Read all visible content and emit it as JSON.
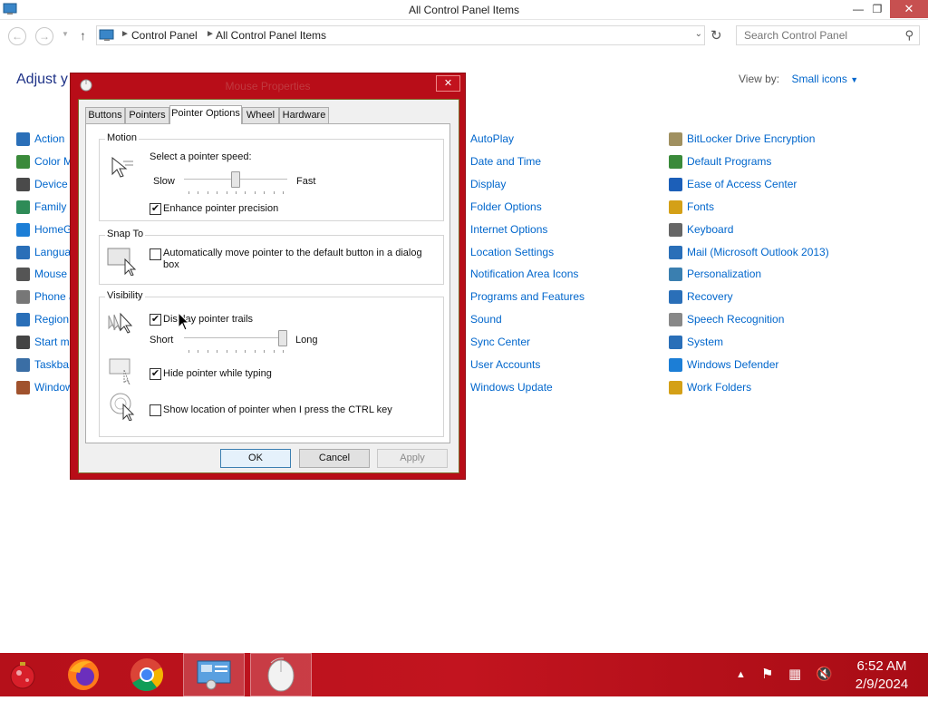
{
  "window": {
    "title": "All Control Panel Items",
    "minimize": "—",
    "maximize": "❐",
    "close": "✕"
  },
  "nav": {
    "breadcrumbs": [
      "Control Panel",
      "All Control Panel Items"
    ],
    "search_placeholder": "Search Control Panel"
  },
  "content": {
    "heading": "Adjust y",
    "view_by_label": "View by:",
    "view_by_value": "Small icons",
    "col1": [
      "Action",
      "Color M",
      "Device",
      "Family",
      "HomeG",
      "Langua",
      "Mouse",
      "Phone a",
      "Region",
      "Start m",
      "Taskba",
      "Window"
    ],
    "col2": [
      "AutoPlay",
      "Date and Time",
      "Display",
      "Folder Options",
      "Internet Options",
      "Location Settings",
      "Notification Area Icons",
      "Programs and Features",
      "Sound",
      "Sync Center",
      "User Accounts",
      "Windows Update"
    ],
    "col3": [
      "BitLocker Drive Encryption",
      "Default Programs",
      "Ease of Access Center",
      "Fonts",
      "Keyboard",
      "Mail (Microsoft Outlook 2013)",
      "Personalization",
      "Recovery",
      "Speech Recognition",
      "System",
      "Windows Defender",
      "Work Folders"
    ],
    "col1_colors": [
      "#2a6fb8",
      "#3a8a3a",
      "#4a4a4a",
      "#2e8b57",
      "#1c7ed6",
      "#2a6fb8",
      "#555555",
      "#777777",
      "#2a6fb8",
      "#444444",
      "#3a6ea5",
      "#a0522d"
    ],
    "col2_colors": [
      "#2a6fb8",
      "#3a7fb0",
      "#2a6fb8",
      "#d4a017",
      "#2a6fb8",
      "#3a7fb0",
      "#666666",
      "#3a8a3a",
      "#888888",
      "#2e8b57",
      "#2a6fb8",
      "#2a6fb8"
    ],
    "col3_colors": [
      "#a09060",
      "#3a8a3a",
      "#1c5fb8",
      "#d4a017",
      "#666666",
      "#2a6fb8",
      "#3a7fb0",
      "#2a6fb8",
      "#888888",
      "#2a6fb8",
      "#1c7ed6",
      "#d4a017"
    ]
  },
  "dialog": {
    "title": "Mouse Properties",
    "close": "✕",
    "tabs": [
      "Buttons",
      "Pointers",
      "Pointer Options",
      "Wheel",
      "Hardware"
    ],
    "active_tab": "Pointer Options",
    "motion": {
      "legend": "Motion",
      "speed_label": "Select a pointer speed:",
      "slow": "Slow",
      "fast": "Fast",
      "speed_value": 0.5,
      "enhance_label": "Enhance pointer precision",
      "enhance_checked": true
    },
    "snap": {
      "legend": "Snap To",
      "label_line1": "Automatically move pointer to the default button in a dialog",
      "label_line2": "box",
      "checked": false
    },
    "visibility": {
      "legend": "Visibility",
      "trails_label": "Display pointer trails",
      "trails_checked": true,
      "short": "Short",
      "long": "Long",
      "trails_value": 1.0,
      "hide_label": "Hide pointer while typing",
      "hide_checked": true,
      "ctrl_label": "Show location of pointer when I press the CTRL key",
      "ctrl_checked": false
    },
    "buttons": {
      "ok": "OK",
      "cancel": "Cancel",
      "apply": "Apply"
    }
  },
  "taskbar": {
    "apps": [
      "start-ornament",
      "firefox",
      "chrome",
      "control-panel",
      "mouse-properties"
    ],
    "time": "6:52 AM",
    "date": "2/9/2024"
  }
}
